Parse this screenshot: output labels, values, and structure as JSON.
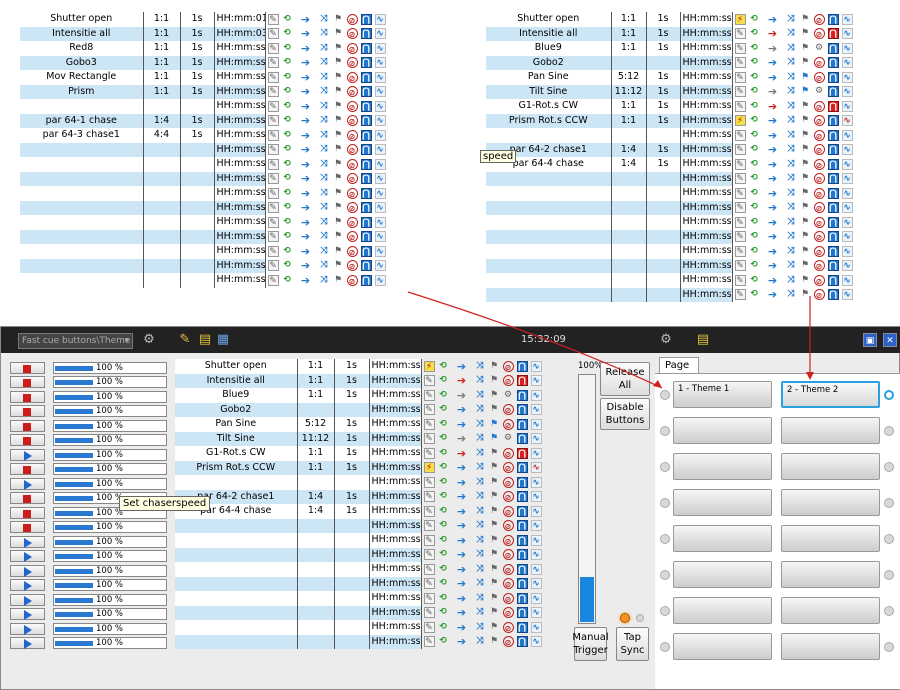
{
  "top_left_table": {
    "rows": [
      {
        "name": "Shutter open",
        "ratio": "1:1",
        "time": "1s",
        "hold": "HH:mm:01"
      },
      {
        "name": "Intensitie all",
        "ratio": "1:1",
        "time": "1s",
        "hold": "HH:mm:03"
      },
      {
        "name": "Red8",
        "ratio": "1:1",
        "time": "1s",
        "hold": "HH:mm:ss"
      },
      {
        "name": "Gobo3",
        "ratio": "1:1",
        "time": "1s",
        "hold": "HH:mm:ss"
      },
      {
        "name": "Mov Rectangle",
        "ratio": "1:1",
        "time": "1s",
        "hold": "HH:mm:ss"
      },
      {
        "name": "Prism",
        "ratio": "1:1",
        "time": "1s",
        "hold": "HH:mm:ss"
      },
      {
        "name": "",
        "ratio": "",
        "time": "",
        "hold": "HH:mm:ss"
      },
      {
        "name": "par 64-1 chase",
        "ratio": "1:4",
        "time": "1s",
        "hold": "HH:mm:ss"
      },
      {
        "name": "par 64-3 chase1",
        "ratio": "4:4",
        "time": "1s",
        "hold": "HH:mm:ss"
      },
      {
        "name": "",
        "ratio": "",
        "time": "",
        "hold": "HH:mm:ss"
      },
      {
        "name": "",
        "ratio": "",
        "time": "",
        "hold": "HH:mm:ss"
      },
      {
        "name": "",
        "ratio": "",
        "time": "",
        "hold": "HH:mm:ss"
      },
      {
        "name": "",
        "ratio": "",
        "time": "",
        "hold": "HH:mm:ss"
      },
      {
        "name": "",
        "ratio": "",
        "time": "",
        "hold": "HH:mm:ss"
      },
      {
        "name": "",
        "ratio": "",
        "time": "",
        "hold": "HH:mm:ss"
      },
      {
        "name": "",
        "ratio": "",
        "time": "",
        "hold": "HH:mm:ss"
      },
      {
        "name": "",
        "ratio": "",
        "time": "",
        "hold": "HH:mm:ss"
      },
      {
        "name": "",
        "ratio": "",
        "time": "",
        "hold": "HH:mm:ss"
      },
      {
        "name": "",
        "ratio": "",
        "time": "",
        "hold": "HH:mm:ss"
      }
    ]
  },
  "top_right_table": {
    "rows": [
      {
        "name": "Shutter open",
        "ratio": "1:1",
        "time": "1s",
        "hold": "HH:mm:ss"
      },
      {
        "name": "Intensitie all",
        "ratio": "1:1",
        "time": "1s",
        "hold": "HH:mm:ss"
      },
      {
        "name": "Blue9",
        "ratio": "1:1",
        "time": "1s",
        "hold": "HH:mm:ss"
      },
      {
        "name": "Gobo2",
        "ratio": "",
        "time": "",
        "hold": "HH:mm:ss"
      },
      {
        "name": "Pan Sine",
        "ratio": "5:12",
        "time": "1s",
        "hold": "HH:mm:ss"
      },
      {
        "name": "Tilt Sine",
        "ratio": "11:12",
        "time": "1s",
        "hold": "HH:mm:ss"
      },
      {
        "name": "G1-Rot.s CW",
        "ratio": "1:1",
        "time": "1s",
        "hold": "HH:mm:ss"
      },
      {
        "name": "Prism Rot.s CCW",
        "ratio": "1:1",
        "time": "1s",
        "hold": "HH:mm:ss"
      },
      {
        "name": "",
        "ratio": "",
        "time": "",
        "hold": "HH:mm:ss"
      },
      {
        "name": "par 64-2 chase1",
        "ratio": "1:4",
        "time": "1s",
        "hold": "HH:mm:ss"
      },
      {
        "name": "par 64-4 chase",
        "ratio": "1:4",
        "time": "1s",
        "hold": "HH:mm:ss"
      },
      {
        "name": "",
        "ratio": "",
        "time": "",
        "hold": "HH:mm:ss"
      },
      {
        "name": "",
        "ratio": "",
        "time": "",
        "hold": "HH:mm:ss"
      },
      {
        "name": "",
        "ratio": "",
        "time": "",
        "hold": "HH:mm:ss"
      },
      {
        "name": "",
        "ratio": "",
        "time": "",
        "hold": "HH:mm:ss"
      },
      {
        "name": "",
        "ratio": "",
        "time": "",
        "hold": "HH:mm:ss"
      },
      {
        "name": "",
        "ratio": "",
        "time": "",
        "hold": "HH:mm:ss"
      },
      {
        "name": "",
        "ratio": "",
        "time": "",
        "hold": "HH:mm:ss"
      },
      {
        "name": "",
        "ratio": "",
        "time": "",
        "hold": "HH:mm:ss"
      },
      {
        "name": "",
        "ratio": "",
        "time": "",
        "hold": "HH:mm:ss"
      }
    ]
  },
  "tooltip_top": "speed",
  "panel": {
    "combo_value": "Fast cue buttons\\Theme",
    "clock": "15:32:09",
    "tooltip": "Set chaserspeed",
    "slider_label": "100%",
    "slider_level_percent": 18,
    "release_label": "Release All",
    "disable_label": "Disable Buttons",
    "manual_label": "Manual Trigger",
    "tap_label": "Tap Sync",
    "page_tab": "Page 1",
    "themes": [
      "1 - Theme 1",
      "2 - Theme 2"
    ],
    "cue_percent": "100 %",
    "cue_states": [
      "stop",
      "stop",
      "stop",
      "stop",
      "stop",
      "stop",
      "play",
      "stop",
      "play",
      "stop",
      "stop",
      "stop",
      "play",
      "play",
      "play",
      "play",
      "play",
      "play",
      "play",
      "play"
    ],
    "rows": [
      {
        "name": "Shutter open",
        "ratio": "1:1",
        "time": "1s",
        "hold": "HH:mm:ss"
      },
      {
        "name": "Intensitie all",
        "ratio": "1:1",
        "time": "1s",
        "hold": "HH:mm:ss"
      },
      {
        "name": "Blue9",
        "ratio": "1:1",
        "time": "1s",
        "hold": "HH:mm:ss"
      },
      {
        "name": "Gobo2",
        "ratio": "",
        "time": "",
        "hold": "HH:mm:ss"
      },
      {
        "name": "Pan Sine",
        "ratio": "5:12",
        "time": "1s",
        "hold": "HH:mm:ss"
      },
      {
        "name": "Tilt Sine",
        "ratio": "11:12",
        "time": "1s",
        "hold": "HH:mm:ss"
      },
      {
        "name": "G1-Rot.s CW",
        "ratio": "1:1",
        "time": "1s",
        "hold": "HH:mm:ss"
      },
      {
        "name": "Prism Rot.s CCW",
        "ratio": "1:1",
        "time": "1s",
        "hold": "HH:mm:ss"
      },
      {
        "name": "",
        "ratio": "",
        "time": "",
        "hold": "HH:mm:ss"
      },
      {
        "name": "par 64-2 chase1",
        "ratio": "1:4",
        "time": "1s",
        "hold": "HH:mm:ss"
      },
      {
        "name": "par 64-4 chase",
        "ratio": "1:4",
        "time": "1s",
        "hold": "HH:mm:ss"
      },
      {
        "name": "",
        "ratio": "",
        "time": "",
        "hold": "HH:mm:ss"
      },
      {
        "name": "",
        "ratio": "",
        "time": "",
        "hold": "HH:mm:ss"
      },
      {
        "name": "",
        "ratio": "",
        "time": "",
        "hold": "HH:mm:ss"
      },
      {
        "name": "",
        "ratio": "",
        "time": "",
        "hold": "HH:mm:ss"
      },
      {
        "name": "",
        "ratio": "",
        "time": "",
        "hold": "HH:mm:ss"
      },
      {
        "name": "",
        "ratio": "",
        "time": "",
        "hold": "HH:mm:ss"
      },
      {
        "name": "",
        "ratio": "",
        "time": "",
        "hold": "HH:mm:ss"
      },
      {
        "name": "",
        "ratio": "",
        "time": "",
        "hold": "HH:mm:ss"
      },
      {
        "name": "",
        "ratio": "",
        "time": "",
        "hold": "HH:mm:ss"
      }
    ]
  },
  "colors": {
    "row_blue": "#cde6f6",
    "accent_blue": "#2277cc",
    "stop_red": "#cc1c1c",
    "annotation_red": "#d02020",
    "selected_border": "#2aa0e0"
  }
}
